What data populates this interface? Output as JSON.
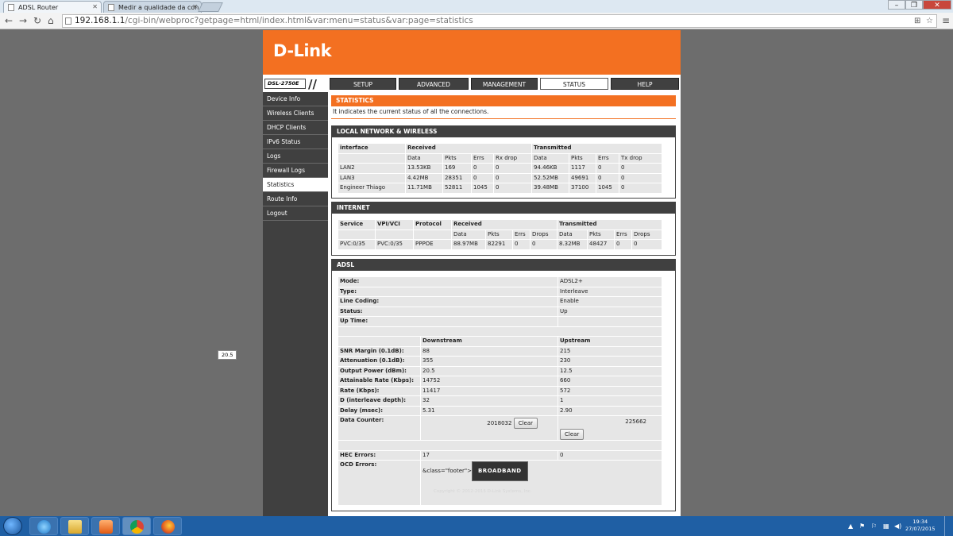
{
  "browser": {
    "tabs": [
      {
        "title": "ADSL Router"
      },
      {
        "title": "Medir a qualidade da con"
      }
    ],
    "url_host": "192.168.1.1",
    "url_path": "/cgi-bin/webproc?getpage=html/index.html&var:menu=status&var:page=statistics"
  },
  "router": {
    "logo": "D-Link",
    "model": "DSL-2750E",
    "top_nav": [
      "SETUP",
      "ADVANCED",
      "MANAGEMENT",
      "STATUS",
      "HELP"
    ],
    "active_nav": "STATUS",
    "sidebar": [
      "Device Info",
      "Wireless Clients",
      "DHCP Clients",
      "IPv6 Status",
      "Logs",
      "Firewall Logs",
      "Statistics",
      "Route Info",
      "Logout"
    ],
    "active_sidebar": "Statistics",
    "section_title": "STATISTICS",
    "section_desc": "It indicates the current status of all the connections."
  },
  "lan": {
    "title": "LOCAL NETWORK & WIRELESS",
    "h1": {
      "interface": "interface",
      "received": "Received",
      "transmitted": "Transmitted"
    },
    "h2": [
      "Data",
      "Pkts",
      "Errs",
      "Rx drop",
      "Data",
      "Pkts",
      "Errs",
      "Tx drop"
    ],
    "rows": [
      [
        "LAN2",
        "13.53KB",
        "169",
        "0",
        "0",
        "94.46KB",
        "1117",
        "0",
        "0"
      ],
      [
        "LAN3",
        "4.42MB",
        "28351",
        "0",
        "0",
        "52.52MB",
        "49691",
        "0",
        "0"
      ],
      [
        "Engineer Thiago",
        "11.71MB",
        "52811",
        "1045",
        "0",
        "39.48MB",
        "37100",
        "1045",
        "0"
      ]
    ]
  },
  "internet": {
    "title": "INTERNET",
    "h1": [
      "Service",
      "VPI/VCI",
      "Protocol",
      "Received",
      "Transmitted"
    ],
    "h2": [
      "Data",
      "Pkts",
      "Errs",
      "Drops",
      "Data",
      "Pkts",
      "Errs",
      "Drops"
    ],
    "row": [
      "PVC:0/35",
      "PVC:0/35",
      "PPPOE",
      "88.97MB",
      "82291",
      "0",
      "0",
      "8.32MB",
      "48427",
      "0",
      "0"
    ]
  },
  "adsl": {
    "title": "ADSL",
    "mode_label": "Mode:",
    "mode": "ADSL2+",
    "type_label": "Type:",
    "type": "Interleave",
    "coding_label": "Line Coding:",
    "coding": "Enable",
    "status_label": "Status:",
    "status": "Up",
    "uptime_label": "Up Time:",
    "uptime": "",
    "downstream": "Downstream",
    "upstream": "Upstream",
    "metrics": [
      {
        "label": "SNR Margin (0.1dB):",
        "down": "88",
        "up": "215"
      },
      {
        "label": "Attenuation (0.1dB):",
        "down": "355",
        "up": "230"
      },
      {
        "label": "Output Power (dBm):",
        "down": "20.5",
        "up": "12.5"
      },
      {
        "label": "Attainable Rate (Kbps):",
        "down": "14752",
        "up": "660"
      },
      {
        "label": "Rate (Kbps):",
        "down": "11417",
        "up": "572"
      },
      {
        "label": "D (interleave depth):",
        "down": "32",
        "up": "1"
      },
      {
        "label": "Delay (msec):",
        "down": "5.31",
        "up": "2.90"
      }
    ],
    "counter_label": "Data Counter:",
    "counter_down": "2018032",
    "counter_up": "225662",
    "clear_label": "Clear",
    "hec_label": "HEC Errors:",
    "hec_down": "17",
    "hec_up": "0",
    "ocd_label": "OCD Errors:",
    "ocd_text": "&class=\"footer\">",
    "broadband": "BROADBAND",
    "copyright": "Copyright © 2012-2015 D-Link Systems, Inc.",
    "tooltip": "20.5"
  },
  "taskbar": {
    "time": "19:34",
    "date": "27/07/2015"
  }
}
